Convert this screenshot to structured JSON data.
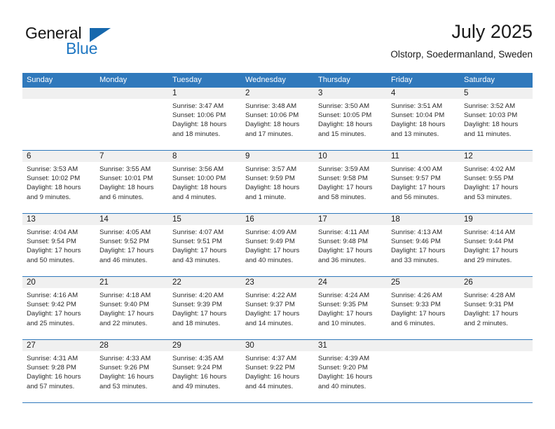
{
  "logo": {
    "word_top": "General",
    "word_bottom": "Blue",
    "triangle": "triangle-mark"
  },
  "header": {
    "title": "July 2025",
    "location": "Olstorp, Soedermanland, Sweden"
  },
  "calendar": {
    "weekdays": [
      "Sunday",
      "Monday",
      "Tuesday",
      "Wednesday",
      "Thursday",
      "Friday",
      "Saturday"
    ],
    "accent_color": "#3079bc",
    "day_band_color": "#f0f0f0",
    "weeks": [
      [
        {
          "day": ""
        },
        {
          "day": ""
        },
        {
          "day": "1",
          "sunrise": "Sunrise: 3:47 AM",
          "sunset": "Sunset: 10:06 PM",
          "daylight1": "Daylight: 18 hours",
          "daylight2": "and 18 minutes."
        },
        {
          "day": "2",
          "sunrise": "Sunrise: 3:48 AM",
          "sunset": "Sunset: 10:06 PM",
          "daylight1": "Daylight: 18 hours",
          "daylight2": "and 17 minutes."
        },
        {
          "day": "3",
          "sunrise": "Sunrise: 3:50 AM",
          "sunset": "Sunset: 10:05 PM",
          "daylight1": "Daylight: 18 hours",
          "daylight2": "and 15 minutes."
        },
        {
          "day": "4",
          "sunrise": "Sunrise: 3:51 AM",
          "sunset": "Sunset: 10:04 PM",
          "daylight1": "Daylight: 18 hours",
          "daylight2": "and 13 minutes."
        },
        {
          "day": "5",
          "sunrise": "Sunrise: 3:52 AM",
          "sunset": "Sunset: 10:03 PM",
          "daylight1": "Daylight: 18 hours",
          "daylight2": "and 11 minutes."
        }
      ],
      [
        {
          "day": "6",
          "sunrise": "Sunrise: 3:53 AM",
          "sunset": "Sunset: 10:02 PM",
          "daylight1": "Daylight: 18 hours",
          "daylight2": "and 9 minutes."
        },
        {
          "day": "7",
          "sunrise": "Sunrise: 3:55 AM",
          "sunset": "Sunset: 10:01 PM",
          "daylight1": "Daylight: 18 hours",
          "daylight2": "and 6 minutes."
        },
        {
          "day": "8",
          "sunrise": "Sunrise: 3:56 AM",
          "sunset": "Sunset: 10:00 PM",
          "daylight1": "Daylight: 18 hours",
          "daylight2": "and 4 minutes."
        },
        {
          "day": "9",
          "sunrise": "Sunrise: 3:57 AM",
          "sunset": "Sunset: 9:59 PM",
          "daylight1": "Daylight: 18 hours",
          "daylight2": "and 1 minute."
        },
        {
          "day": "10",
          "sunrise": "Sunrise: 3:59 AM",
          "sunset": "Sunset: 9:58 PM",
          "daylight1": "Daylight: 17 hours",
          "daylight2": "and 58 minutes."
        },
        {
          "day": "11",
          "sunrise": "Sunrise: 4:00 AM",
          "sunset": "Sunset: 9:57 PM",
          "daylight1": "Daylight: 17 hours",
          "daylight2": "and 56 minutes."
        },
        {
          "day": "12",
          "sunrise": "Sunrise: 4:02 AM",
          "sunset": "Sunset: 9:55 PM",
          "daylight1": "Daylight: 17 hours",
          "daylight2": "and 53 minutes."
        }
      ],
      [
        {
          "day": "13",
          "sunrise": "Sunrise: 4:04 AM",
          "sunset": "Sunset: 9:54 PM",
          "daylight1": "Daylight: 17 hours",
          "daylight2": "and 50 minutes."
        },
        {
          "day": "14",
          "sunrise": "Sunrise: 4:05 AM",
          "sunset": "Sunset: 9:52 PM",
          "daylight1": "Daylight: 17 hours",
          "daylight2": "and 46 minutes."
        },
        {
          "day": "15",
          "sunrise": "Sunrise: 4:07 AM",
          "sunset": "Sunset: 9:51 PM",
          "daylight1": "Daylight: 17 hours",
          "daylight2": "and 43 minutes."
        },
        {
          "day": "16",
          "sunrise": "Sunrise: 4:09 AM",
          "sunset": "Sunset: 9:49 PM",
          "daylight1": "Daylight: 17 hours",
          "daylight2": "and 40 minutes."
        },
        {
          "day": "17",
          "sunrise": "Sunrise: 4:11 AM",
          "sunset": "Sunset: 9:48 PM",
          "daylight1": "Daylight: 17 hours",
          "daylight2": "and 36 minutes."
        },
        {
          "day": "18",
          "sunrise": "Sunrise: 4:13 AM",
          "sunset": "Sunset: 9:46 PM",
          "daylight1": "Daylight: 17 hours",
          "daylight2": "and 33 minutes."
        },
        {
          "day": "19",
          "sunrise": "Sunrise: 4:14 AM",
          "sunset": "Sunset: 9:44 PM",
          "daylight1": "Daylight: 17 hours",
          "daylight2": "and 29 minutes."
        }
      ],
      [
        {
          "day": "20",
          "sunrise": "Sunrise: 4:16 AM",
          "sunset": "Sunset: 9:42 PM",
          "daylight1": "Daylight: 17 hours",
          "daylight2": "and 25 minutes."
        },
        {
          "day": "21",
          "sunrise": "Sunrise: 4:18 AM",
          "sunset": "Sunset: 9:40 PM",
          "daylight1": "Daylight: 17 hours",
          "daylight2": "and 22 minutes."
        },
        {
          "day": "22",
          "sunrise": "Sunrise: 4:20 AM",
          "sunset": "Sunset: 9:39 PM",
          "daylight1": "Daylight: 17 hours",
          "daylight2": "and 18 minutes."
        },
        {
          "day": "23",
          "sunrise": "Sunrise: 4:22 AM",
          "sunset": "Sunset: 9:37 PM",
          "daylight1": "Daylight: 17 hours",
          "daylight2": "and 14 minutes."
        },
        {
          "day": "24",
          "sunrise": "Sunrise: 4:24 AM",
          "sunset": "Sunset: 9:35 PM",
          "daylight1": "Daylight: 17 hours",
          "daylight2": "and 10 minutes."
        },
        {
          "day": "25",
          "sunrise": "Sunrise: 4:26 AM",
          "sunset": "Sunset: 9:33 PM",
          "daylight1": "Daylight: 17 hours",
          "daylight2": "and 6 minutes."
        },
        {
          "day": "26",
          "sunrise": "Sunrise: 4:28 AM",
          "sunset": "Sunset: 9:31 PM",
          "daylight1": "Daylight: 17 hours",
          "daylight2": "and 2 minutes."
        }
      ],
      [
        {
          "day": "27",
          "sunrise": "Sunrise: 4:31 AM",
          "sunset": "Sunset: 9:28 PM",
          "daylight1": "Daylight: 16 hours",
          "daylight2": "and 57 minutes."
        },
        {
          "day": "28",
          "sunrise": "Sunrise: 4:33 AM",
          "sunset": "Sunset: 9:26 PM",
          "daylight1": "Daylight: 16 hours",
          "daylight2": "and 53 minutes."
        },
        {
          "day": "29",
          "sunrise": "Sunrise: 4:35 AM",
          "sunset": "Sunset: 9:24 PM",
          "daylight1": "Daylight: 16 hours",
          "daylight2": "and 49 minutes."
        },
        {
          "day": "30",
          "sunrise": "Sunrise: 4:37 AM",
          "sunset": "Sunset: 9:22 PM",
          "daylight1": "Daylight: 16 hours",
          "daylight2": "and 44 minutes."
        },
        {
          "day": "31",
          "sunrise": "Sunrise: 4:39 AM",
          "sunset": "Sunset: 9:20 PM",
          "daylight1": "Daylight: 16 hours",
          "daylight2": "and 40 minutes."
        },
        {
          "day": ""
        },
        {
          "day": ""
        }
      ]
    ]
  }
}
